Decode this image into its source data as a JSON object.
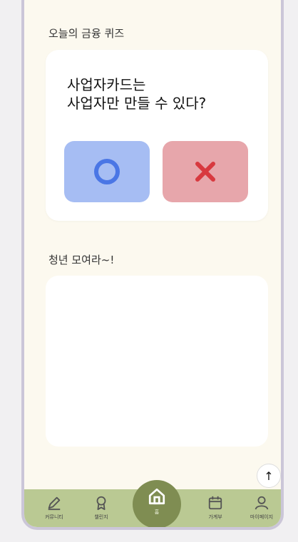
{
  "quiz": {
    "section_title": "오늘의 금융 퀴즈",
    "question_line1": "사업자카드는",
    "question_line2": "사업자만 만들 수 있다?",
    "answer_true_icon": "circle-o-icon",
    "answer_false_icon": "x-icon",
    "answer_true_color": "#4a76e5",
    "answer_false_color": "#d8393f"
  },
  "youth": {
    "section_title": "청년 모여라~!"
  },
  "scroll_top": {
    "icon": "arrow-up-icon",
    "glyph": "↑"
  },
  "nav": {
    "items": [
      {
        "label": "커뮤니티",
        "icon": "pencil-icon"
      },
      {
        "label": "챌린지",
        "icon": "medal-icon"
      },
      {
        "label": "홈",
        "icon": "home-icon",
        "active": true
      },
      {
        "label": "가계부",
        "icon": "calendar-icon"
      },
      {
        "label": "마이페이지",
        "icon": "person-icon"
      }
    ],
    "background": "#bac993",
    "active_color": "#7f8d52"
  }
}
